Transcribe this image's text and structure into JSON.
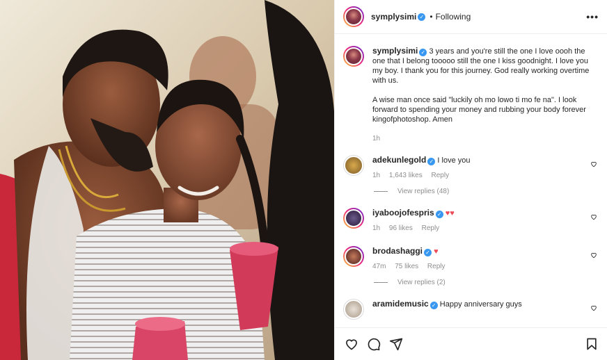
{
  "post": {
    "author": "symplysimi",
    "dot": "•",
    "follow_status": "Following",
    "more": "•••"
  },
  "caption": {
    "author": "symplysimi",
    "text1": "3 years and you're still the one I love oooh the one that I belong tooooo still the one I kiss goodnight. I love you my boy. I thank you for this journey. God really working overtime with us.",
    "text2": "A wise man once said \"luckily oh mo lowo ti mo fe na\". I look forward to spending your money and rubbing your body forever kingofphotoshop. Amen",
    "time": "1h"
  },
  "comments": [
    {
      "user": "adekunlegold",
      "text": "I love you",
      "time": "1h",
      "likes": "1,643 likes",
      "reply": "Reply",
      "view_replies": "View replies (48)"
    },
    {
      "user": "iyaboojofespris",
      "text": "",
      "hearts": "♥♥",
      "time": "1h",
      "likes": "96 likes",
      "reply": "Reply"
    },
    {
      "user": "brodashaggi",
      "text": "",
      "hearts": "♥",
      "time": "47m",
      "likes": "75 likes",
      "reply": "Reply",
      "view_replies": "View replies (2)"
    },
    {
      "user": "aramidemusic",
      "text": "Happy anniversary guys"
    }
  ],
  "icons": {
    "like": "heart-icon",
    "comment": "comment-icon",
    "share": "share-icon",
    "save": "bookmark-icon",
    "verified": "verified-badge-icon",
    "verified_glyph": "✓"
  },
  "colors": {
    "verified": "#3897f0",
    "heart": "#ed4956",
    "muted": "#8e8e8e"
  }
}
